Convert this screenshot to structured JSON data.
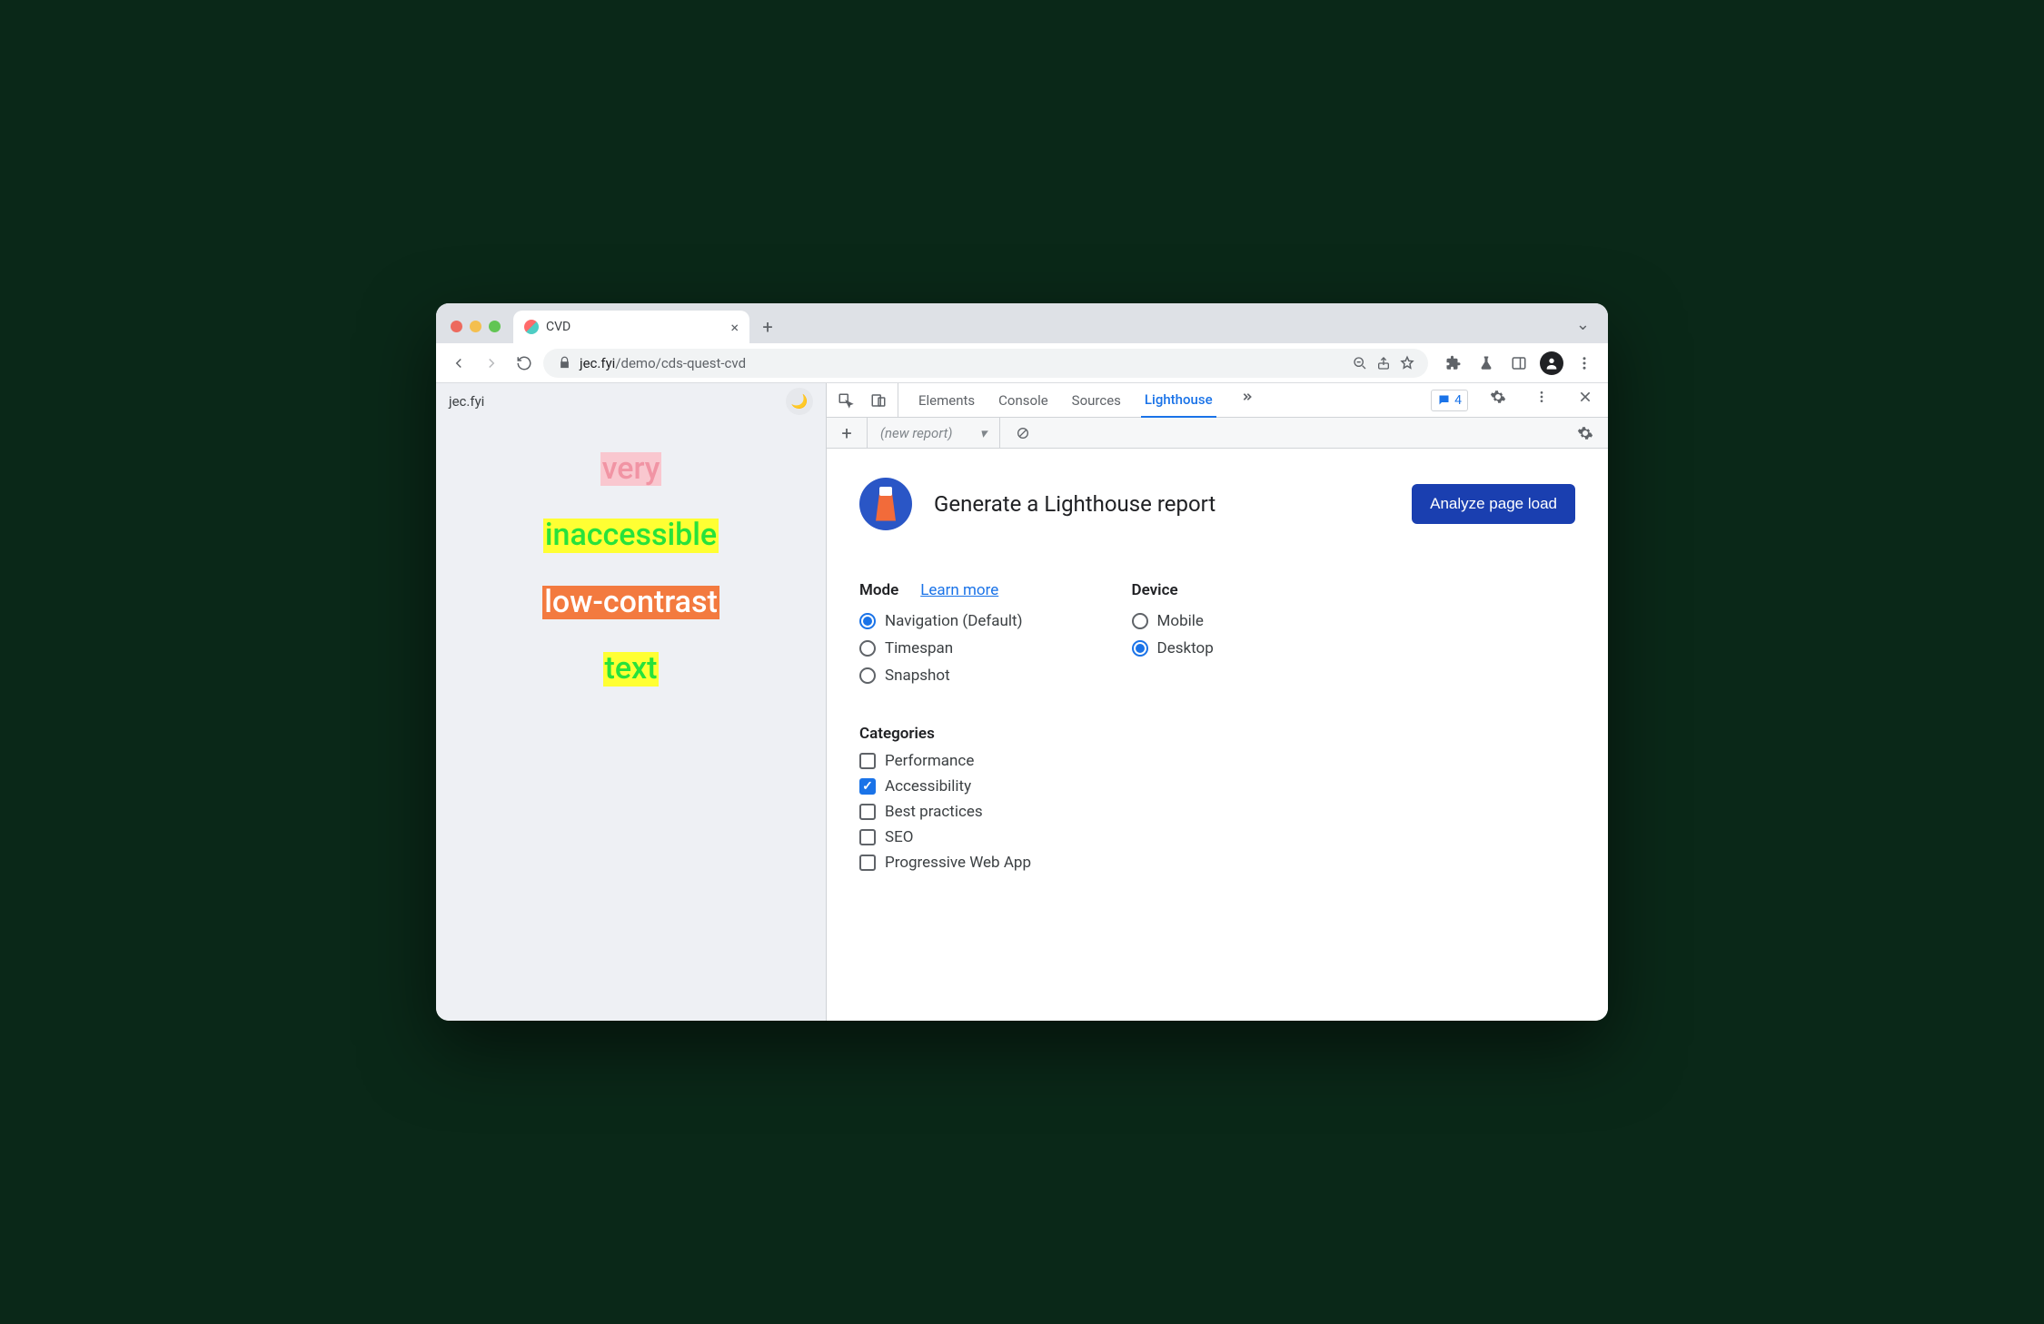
{
  "browser": {
    "tab_title": "CVD",
    "url_host": "jec.fyi",
    "url_path": "/demo/cds-quest-cvd"
  },
  "page": {
    "site_name": "jec.fyi",
    "words": [
      "very",
      "inaccessible",
      "low-contrast",
      "text"
    ]
  },
  "devtools": {
    "tabs": [
      "Elements",
      "Console",
      "Sources",
      "Lighthouse"
    ],
    "active_tab": "Lighthouse",
    "issues_count": "4",
    "subbar_label": "(new report)"
  },
  "lighthouse": {
    "title": "Generate a Lighthouse report",
    "analyze_label": "Analyze page load",
    "mode_label": "Mode",
    "learn_more": "Learn more",
    "modes": [
      {
        "label": "Navigation (Default)",
        "checked": true
      },
      {
        "label": "Timespan",
        "checked": false
      },
      {
        "label": "Snapshot",
        "checked": false
      }
    ],
    "device_label": "Device",
    "devices": [
      {
        "label": "Mobile",
        "checked": false
      },
      {
        "label": "Desktop",
        "checked": true
      }
    ],
    "categories_label": "Categories",
    "categories": [
      {
        "label": "Performance",
        "checked": false
      },
      {
        "label": "Accessibility",
        "checked": true
      },
      {
        "label": "Best practices",
        "checked": false
      },
      {
        "label": "SEO",
        "checked": false
      },
      {
        "label": "Progressive Web App",
        "checked": false
      }
    ]
  }
}
